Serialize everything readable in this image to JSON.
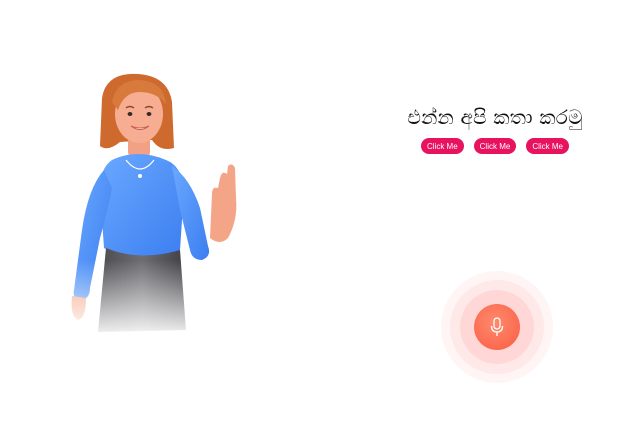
{
  "heading": "එන්න අපි කතා කරමු",
  "buttons": [
    {
      "label": "Click Me"
    },
    {
      "label": "Click Me"
    },
    {
      "label": "Click Me"
    }
  ],
  "icons": {
    "mic": "microphone-icon",
    "avatar": "woman-waving-illustration"
  },
  "colors": {
    "button_bg": "#e8125f",
    "mic_bg": "#fb6a4f",
    "shirt": "#4d8ff5",
    "hair": "#d8743a"
  }
}
